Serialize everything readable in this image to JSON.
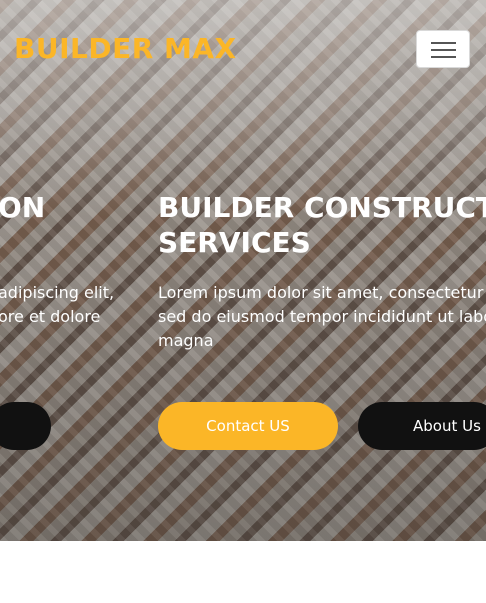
{
  "brand": {
    "name": "BUILDER MAX"
  },
  "nav": {
    "toggler_icon": "hamburger-icon"
  },
  "slides": {
    "prev": {
      "title_line1": "ON",
      "text_line1": "adipiscing elit,",
      "text_line2": "ore et dolore"
    },
    "current": {
      "title_line1": "BUILDER CONSTRUCTIO",
      "title_line2": "SERVICES",
      "text_line1": "Lorem ipsum dolor sit amet, consectetur a",
      "text_line2": "sed do eiusmod tempor incididunt ut labo",
      "text_line3": "magna",
      "contact_label": "Contact US",
      "about_label": "About Us"
    }
  },
  "colors": {
    "accent": "#fbb627",
    "dark_button": "#111111"
  }
}
